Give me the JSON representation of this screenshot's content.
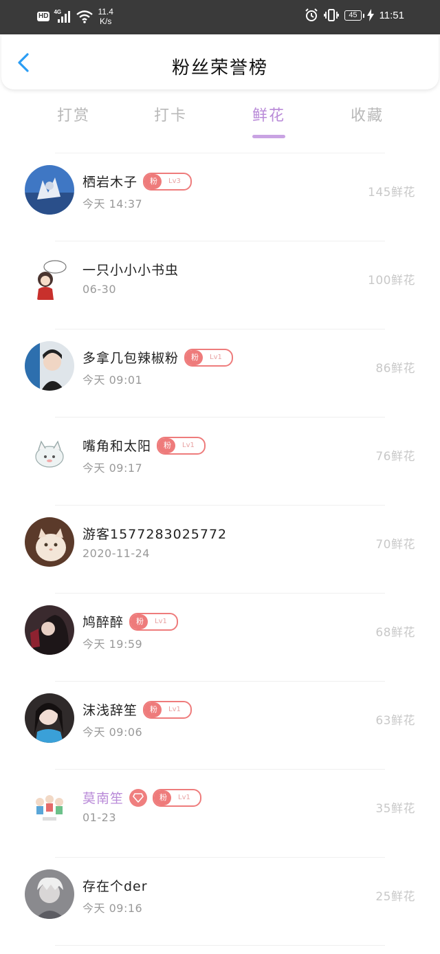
{
  "status_bar": {
    "hd": "HD",
    "network": "4G",
    "speed_value": "11.4",
    "speed_unit": "K/s",
    "battery": "45",
    "time": "11:51"
  },
  "header": {
    "title": "粉丝荣誉榜"
  },
  "tabs": [
    {
      "label": "打赏",
      "active": false
    },
    {
      "label": "打卡",
      "active": false
    },
    {
      "label": "鲜花",
      "active": true
    },
    {
      "label": "收藏",
      "active": false
    }
  ],
  "fans": [
    {
      "name": "栖岩木子",
      "badge": {
        "label": "粉",
        "level": "Lv3"
      },
      "time": "今天 14:37",
      "flowers": "145鲜花"
    },
    {
      "name": "一只小小小书虫",
      "badge": null,
      "time": "06-30",
      "flowers": "100鲜花"
    },
    {
      "name": "多拿几包辣椒粉",
      "badge": {
        "label": "粉",
        "level": "Lv1"
      },
      "time": "今天 09:01",
      "flowers": "86鲜花"
    },
    {
      "name": "嘴角和太阳",
      "badge": {
        "label": "粉",
        "level": "Lv1"
      },
      "time": "今天 09:17",
      "flowers": "76鲜花"
    },
    {
      "name": "游客1577283025772",
      "badge": null,
      "time": "2020-11-24",
      "flowers": "70鲜花"
    },
    {
      "name": "鸠醉醉",
      "badge": {
        "label": "粉",
        "level": "Lv1"
      },
      "time": "今天 19:59",
      "flowers": "68鲜花"
    },
    {
      "name": "沫浅辞笙",
      "badge": {
        "label": "粉",
        "level": "Lv1"
      },
      "time": "今天 09:06",
      "flowers": "63鲜花"
    },
    {
      "name": "莫南笙",
      "badge": {
        "label": "粉",
        "level": "Lv1"
      },
      "time": "01-23",
      "flowers": "35鲜花"
    },
    {
      "name": "存在个der",
      "badge": null,
      "time": "今天 09:16",
      "flowers": "25鲜花"
    }
  ]
}
